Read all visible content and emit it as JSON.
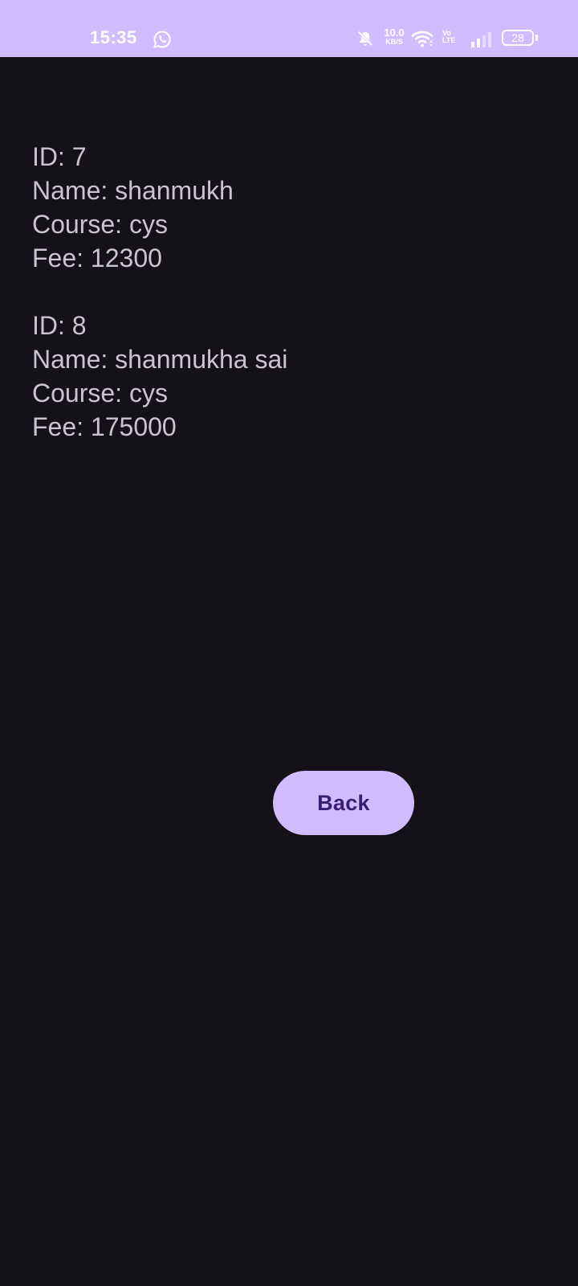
{
  "status_bar": {
    "time": "15:35",
    "net_speed_value": "10.0",
    "net_speed_unit": "KB/S",
    "volte_top": "Vo",
    "volte_bottom": "LTE",
    "battery_level": "28",
    "background_color": "#d0bcff",
    "icons": [
      "whatsapp-icon",
      "mute-icon",
      "wifi-icon",
      "signal-icon",
      "battery-icon"
    ]
  },
  "records": [
    {
      "id_line": "ID: 7",
      "name_line": "Name: shanmukh",
      "course_line": "Course: cys",
      "fee_line": "Fee: 12300"
    },
    {
      "id_line": "ID: 8",
      "name_line": "Name: shanmukha sai",
      "course_line": "Course: cys",
      "fee_line": "Fee: 175000"
    }
  ],
  "back_button": {
    "label": "Back"
  },
  "colors": {
    "background": "#141218",
    "text": "#cac4d0",
    "button_bg": "#d0bcff",
    "button_text": "#381e72"
  }
}
